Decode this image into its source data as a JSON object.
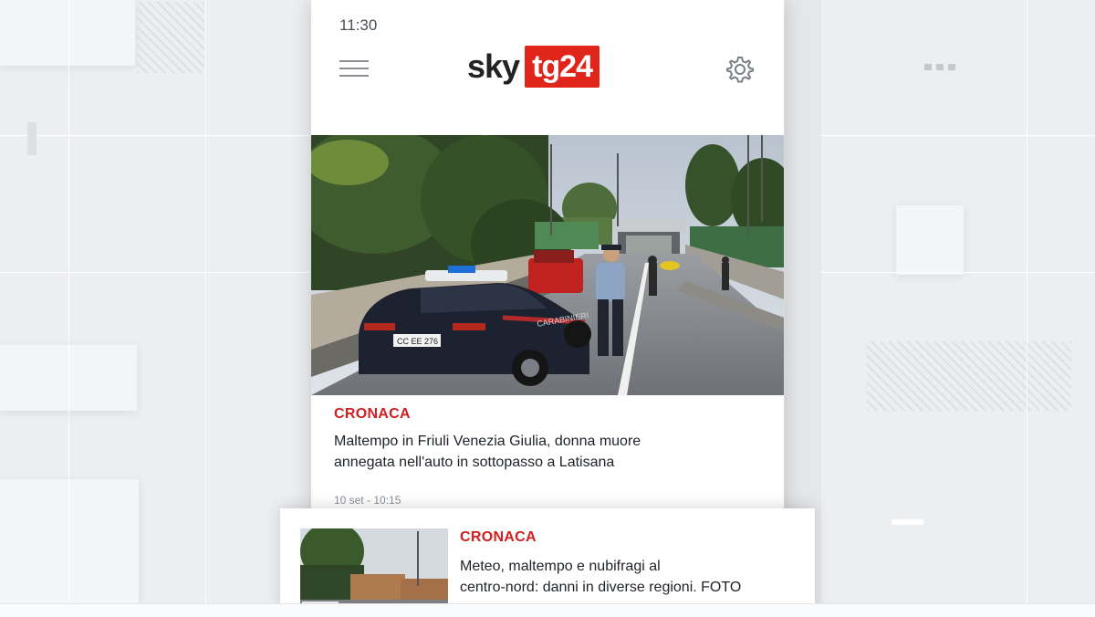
{
  "status_bar": {
    "time": "11:30"
  },
  "header": {
    "logo_sky": "sky",
    "logo_tg": "tg24",
    "menu_icon": "hamburger-menu-icon",
    "settings_icon": "gear-icon"
  },
  "articles": [
    {
      "category": "CRONACA",
      "title_line1": "Maltempo in Friuli Venezia Giulia, donna muore",
      "title_line2": "annegata nell'auto in sottopasso a Latisana",
      "date": "10 set - 10:15",
      "image": {
        "plate": "CC EE 276",
        "car_text": "CARABINIERI"
      }
    },
    {
      "category": "CRONACA",
      "title_line1": "Meteo, maltempo e nubifragi al",
      "title_line2": "centro-nord: danni in diverse regioni. FOTO"
    }
  ],
  "colors": {
    "accent": "#d21f1f",
    "logo_red": "#e1251b"
  }
}
